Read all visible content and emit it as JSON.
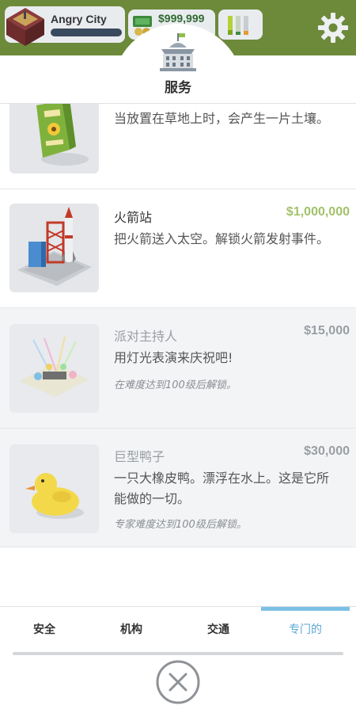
{
  "hud": {
    "city_name": "Angry City",
    "money": "$999,999",
    "icons": [
      "city-thumbnail",
      "money-icon",
      "stats-icon",
      "gear-icon"
    ]
  },
  "panel": {
    "title": "服务"
  },
  "items": [
    {
      "name": "",
      "price": "",
      "description": "当放置在草地上时，会产生一片土壤。",
      "unlock_note": "",
      "locked": false,
      "icon": "plant-grow-bag"
    },
    {
      "name": "火箭站",
      "price": "$1,000,000",
      "description": "把火箭送入太空。解锁火箭发射事件。",
      "unlock_note": "",
      "locked": false,
      "icon": "rocket-station"
    },
    {
      "name": "派对主持人",
      "price": "$15,000",
      "description": "用灯光表演来庆祝吧!",
      "unlock_note": "在难度达到100级后解锁。",
      "locked": true,
      "icon": "party-stage"
    },
    {
      "name": "巨型鸭子",
      "price": "$30,000",
      "description": "一只大橡皮鸭。漂浮在水上。这是它所能做的一切。",
      "unlock_note": "专家难度达到100级后解锁。",
      "locked": true,
      "icon": "rubber-duck"
    }
  ],
  "tabs": [
    {
      "label": "安全",
      "active": false
    },
    {
      "label": "机构",
      "active": false
    },
    {
      "label": "交通",
      "active": false
    },
    {
      "label": "专门的",
      "active": true
    }
  ],
  "colors": {
    "hud_green": "#6c8a3a",
    "price_green": "#a3c26a",
    "tab_active": "#5aa8d8"
  }
}
